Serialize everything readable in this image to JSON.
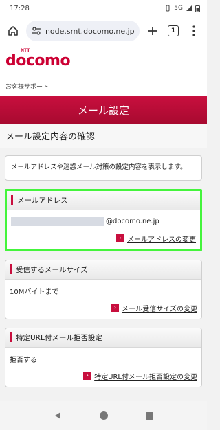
{
  "status_bar": {
    "time": "17:28",
    "network": "5G"
  },
  "browser": {
    "url": "node.smt.docomo.ne.jp",
    "tab_count": "1",
    "icons": [
      "home-icon",
      "site-settings-icon",
      "plus-icon",
      "tabs-icon",
      "more-icon"
    ]
  },
  "brand": {
    "ntt": "NTT",
    "logo": "docomo",
    "color": "#cc0033"
  },
  "support_label": "お客様サポート",
  "page_header": "メール設定",
  "section_title": "メール設定内容の確認",
  "intro_text": "メールアドレスや迷惑メール対策の設定内容を表示します。",
  "cards": [
    {
      "title": "メールアドレス",
      "value": "@docomo.ne.jp",
      "link": "メールアドレスの変更"
    },
    {
      "title": "受信するメールサイズ",
      "value": "10Mバイトまで",
      "link": "メール受信サイズの変更"
    },
    {
      "title": "特定URL付メール拒否設定",
      "value": "拒否する",
      "link": "特定URL付メール拒否設定の変更"
    }
  ],
  "highlight_color": "#44f43c",
  "nav": {
    "icons": [
      "back-icon",
      "home-circle-icon",
      "recents-icon"
    ]
  }
}
